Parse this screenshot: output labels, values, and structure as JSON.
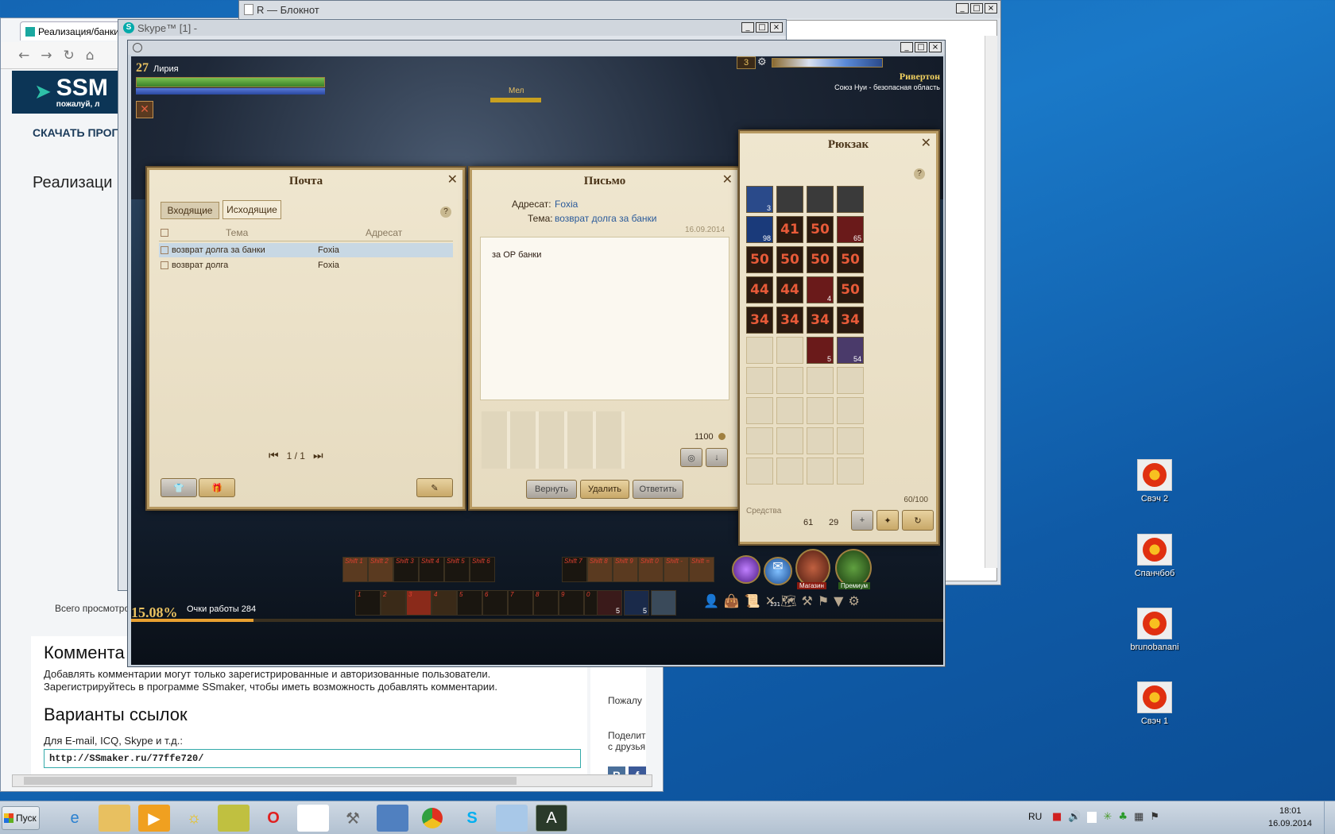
{
  "desktop": {
    "icons": [
      {
        "label": "Свэч 2"
      },
      {
        "label": "Спанчбоб"
      },
      {
        "label": "brunobanani"
      },
      {
        "label": "Свэч 1"
      }
    ]
  },
  "browser": {
    "tab_title": "Реализация/банки",
    "logo": "SSM",
    "logo_sub": "пожалуй, л",
    "nav_link": "СКАЧАТЬ ПРОГ",
    "heading": "Реализаци",
    "views_text": "Всего просмотро",
    "comments_heading": "Коммента",
    "comments_note1": "Добавлять комментарии могут только зарегистрированные и авторизованные пользователи.",
    "comments_note2": "Зарегистрируйтесь в программе SSmaker, чтобы иметь возможность добавлять комментарии.",
    "links_heading": "Варианты ссылок",
    "links_label": "Для E-mail, ICQ, Skype и т.д.:",
    "link_value": "http://SSmaker.ru/77ffe720/",
    "side_text1": "Пожалу",
    "side_text2": "Поделит",
    "side_text3": "с друзья",
    "vk": "B",
    "fb": "f"
  },
  "notepad": {
    "title": "R — Блокнот"
  },
  "skype": {
    "title": "Skype™ [1] -"
  },
  "game": {
    "player": {
      "level": "27",
      "name": "Лирия"
    },
    "target_label": "Мел",
    "minimap": {
      "counter": "3",
      "location": "Ривертон",
      "zone": "Союз Нуи - безопасная область"
    },
    "mail": {
      "title": "Почта",
      "tab_inbox": "Входящие",
      "tab_outbox": "Исходящие",
      "col_subject": "Тема",
      "col_recipient": "Адресат",
      "rows": [
        {
          "subject": "возврат долга за банки",
          "to": "Foxia"
        },
        {
          "subject": "возврат долга",
          "to": "Foxia"
        }
      ],
      "pager": "1 / 1"
    },
    "letter": {
      "title": "Письмо",
      "to_label": "Адресат:",
      "to_value": "Foxia",
      "subject_label": "Тема:",
      "subject_value": "возврат долга за банки",
      "date": "16.09.2014",
      "body": "за ОР банки",
      "money": "1100",
      "btn_return": "Вернуть",
      "btn_delete": "Удалить",
      "btn_reply": "Ответить"
    },
    "backpack": {
      "title": "Рюкзак",
      "capacity": "60/100",
      "funds_label": "Средства",
      "gold": "61",
      "silver": "29",
      "rows": [
        [
          "",
          "",
          "",
          ""
        ],
        [
          "",
          "41",
          "50",
          ""
        ],
        [
          "50",
          "50",
          "50",
          "50"
        ],
        [
          "44",
          "44",
          "",
          "50"
        ],
        [
          "34",
          "34",
          "34",
          "34"
        ]
      ],
      "counts": {
        "potion": "3",
        "blue": "98",
        "red": "65",
        "gem": "4",
        "orb": "5",
        "help": "54"
      }
    },
    "hotbar": {
      "shift_labels": [
        "Shift 1",
        "Shift 2",
        "Shift 3",
        "Shift 4",
        "Shift 5",
        "Shift 6",
        "Shift 7",
        "Shift 8",
        "Shift 9",
        "Shift 0",
        "Shift -",
        "Shift ="
      ],
      "num_labels": [
        "1",
        "2",
        "3",
        "4",
        "5",
        "6",
        "7",
        "8",
        "9",
        "0"
      ],
      "potion_counts": [
        "5",
        "5"
      ]
    },
    "xp_percent": "15.08%",
    "work_points": "Очки работы 284",
    "shop_label": "Магазин",
    "premium_label": "Премиум",
    "bag_count": "131"
  },
  "taskbar": {
    "start": "Пуск",
    "lang": "RU",
    "time": "18:01",
    "date": "16.09.2014"
  }
}
